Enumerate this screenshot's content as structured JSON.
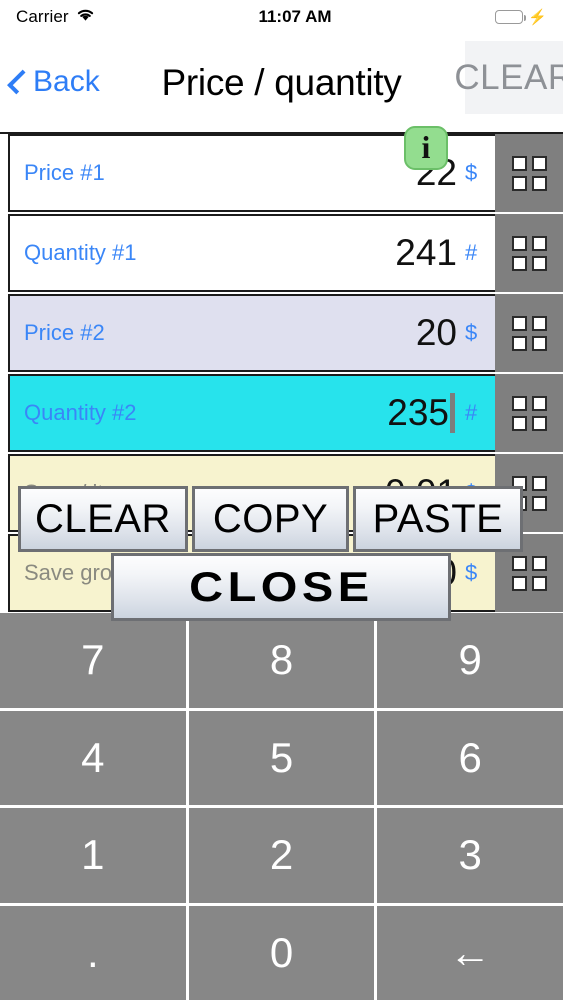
{
  "status_bar": {
    "carrier": "Carrier",
    "wifi_icon": "wifi-icon",
    "time": "11:07 AM",
    "battery_icon": "battery-icon",
    "charging_icon": "lightning-bolt-icon",
    "battery_color": "#4CD964"
  },
  "nav": {
    "back_label": "Back",
    "back_icon": "chevron-left-icon",
    "title": "Price / quantity",
    "clear_label": "CLEAR",
    "info_glyph": "i",
    "accent_color": "#2E7DF6"
  },
  "rows": [
    {
      "label": "Price #1",
      "value": "22",
      "unit": "$",
      "style": "white",
      "caret": false,
      "grid_icon": "grid-2x2-icon"
    },
    {
      "label": "Quantity #1",
      "value": "241",
      "unit": "#",
      "style": "white",
      "caret": false,
      "grid_icon": "grid-2x2-icon"
    },
    {
      "label": "Price #2",
      "value": "20",
      "unit": "$",
      "style": "lilac",
      "caret": false,
      "grid_icon": "grid-2x2-icon"
    },
    {
      "label": "Quantity #2",
      "value": "235",
      "unit": "#",
      "style": "cyan",
      "caret": true,
      "grid_icon": "grid-2x2-icon"
    },
    {
      "label": "Save / item",
      "value": "0.01",
      "unit": "$",
      "style": "cream",
      "caret": false,
      "grid_icon": "grid-2x2-icon"
    },
    {
      "label": "Save gross",
      "value": "0",
      "unit": "$",
      "style": "cream",
      "caret": false,
      "grid_icon": "grid-2x2-icon"
    }
  ],
  "popup": {
    "clear_label": "CLEAR",
    "copy_label": "COPY",
    "paste_label": "PASTE",
    "close_label": "CLOSE"
  },
  "keypad": {
    "keys": [
      "7",
      "8",
      "9",
      "4",
      "5",
      "6",
      "1",
      "2",
      "3",
      ".",
      "0",
      "←"
    ],
    "backspace_icon": "arrow-left-icon"
  }
}
